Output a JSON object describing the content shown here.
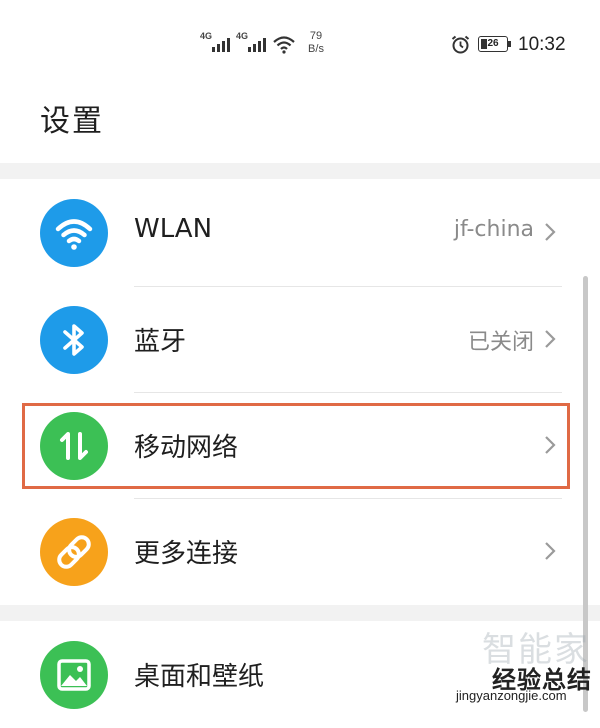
{
  "status_bar": {
    "network_1": "4G",
    "network_2": "4G",
    "speed_value": "79",
    "speed_unit": "B/s",
    "battery_level": "26",
    "time": "10:32"
  },
  "page": {
    "title": "设置"
  },
  "settings_items": [
    {
      "label": "WLAN",
      "value": "jf-china",
      "icon": "wifi-icon",
      "icon_color": "#1e9be9"
    },
    {
      "label": "蓝牙",
      "value": "已关闭",
      "icon": "bluetooth-icon",
      "icon_color": "#1e9be9"
    },
    {
      "label": "移动网络",
      "value": "",
      "icon": "mobile-data-icon",
      "icon_color": "#3cc055",
      "highlighted": true,
      "highlight_color": "#e06a45"
    },
    {
      "label": "更多连接",
      "value": "",
      "icon": "link-icon",
      "icon_color": "#f7a21b"
    },
    {
      "label": "桌面和壁纸",
      "value": "",
      "icon": "image-icon",
      "icon_color": "#3cc055"
    }
  ],
  "watermark": {
    "line1": "智能家",
    "line2": "经验总结",
    "line3": "jingyanzongjie.com"
  }
}
